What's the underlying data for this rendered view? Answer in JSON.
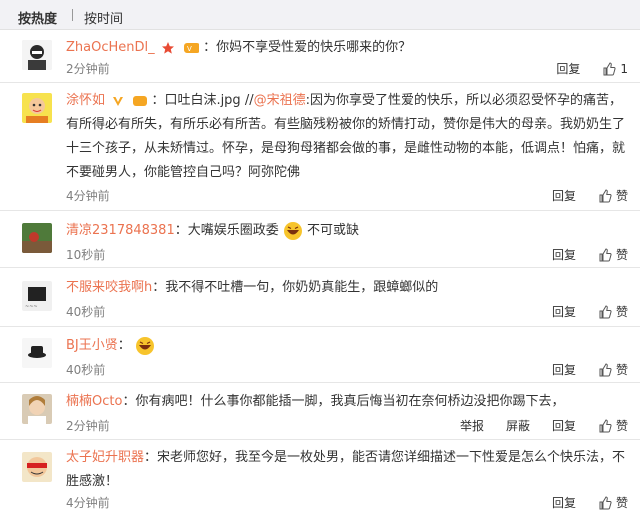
{
  "tabs": {
    "hot": "按热度",
    "time": "按时间"
  },
  "actions": {
    "reply": "回复",
    "like": "赞",
    "report": "举报",
    "block": "屏蔽"
  },
  "comments": [
    {
      "user": "ZhaOcHenDl_",
      "text": "：你妈不享受性爱的快乐哪来的你？",
      "time": "2分钟前"
    },
    {
      "user": "涂怀如",
      "prefix": "：口吐白沫.jpg //",
      "mention": "@宋祖德",
      "text": ":因为你享受了性爱的快乐，所以必须忍受怀孕的痛苦，有所得必有所失，有所乐必有所苦。有些脑残粉被你的矫情打动，赞你是伟大的母亲。我奶奶生了十三个孩子，从未矫情过。怀孕，是母狗母猪都会做的事，是雌性动物的本能，低调点！怕痛，就不要碰男人，你能管控自己吗？阿弥陀佛",
      "time": "4分钟前"
    },
    {
      "user": "清凉2317848381",
      "text": "：大嘴娱乐圈政委",
      "text2": "不可或缺",
      "time": "10秒前"
    },
    {
      "user": "不服来咬我啊h",
      "text": "：我不得不吐槽一句，你奶奶真能生，跟蟑螂似的",
      "time": "40秒前"
    },
    {
      "user": "BJ王小贤",
      "text": "：",
      "time": "40秒前"
    },
    {
      "user": "楠楠Octo",
      "text": "：你有病吧！什么事你都能插一脚，我真后悔当初在奈何桥边没把你踢下去，",
      "time": "2分钟前"
    },
    {
      "user": "太子妃升职器",
      "text": "：宋老师您好，我至今是一枚处男，能否请您详细描述一下性爱是怎么个快乐法，不胜感激！",
      "time": "4分钟前"
    }
  ],
  "colors": {
    "username": "#eb7350",
    "time": "#808080",
    "tabbar": "#f2f2f5"
  }
}
